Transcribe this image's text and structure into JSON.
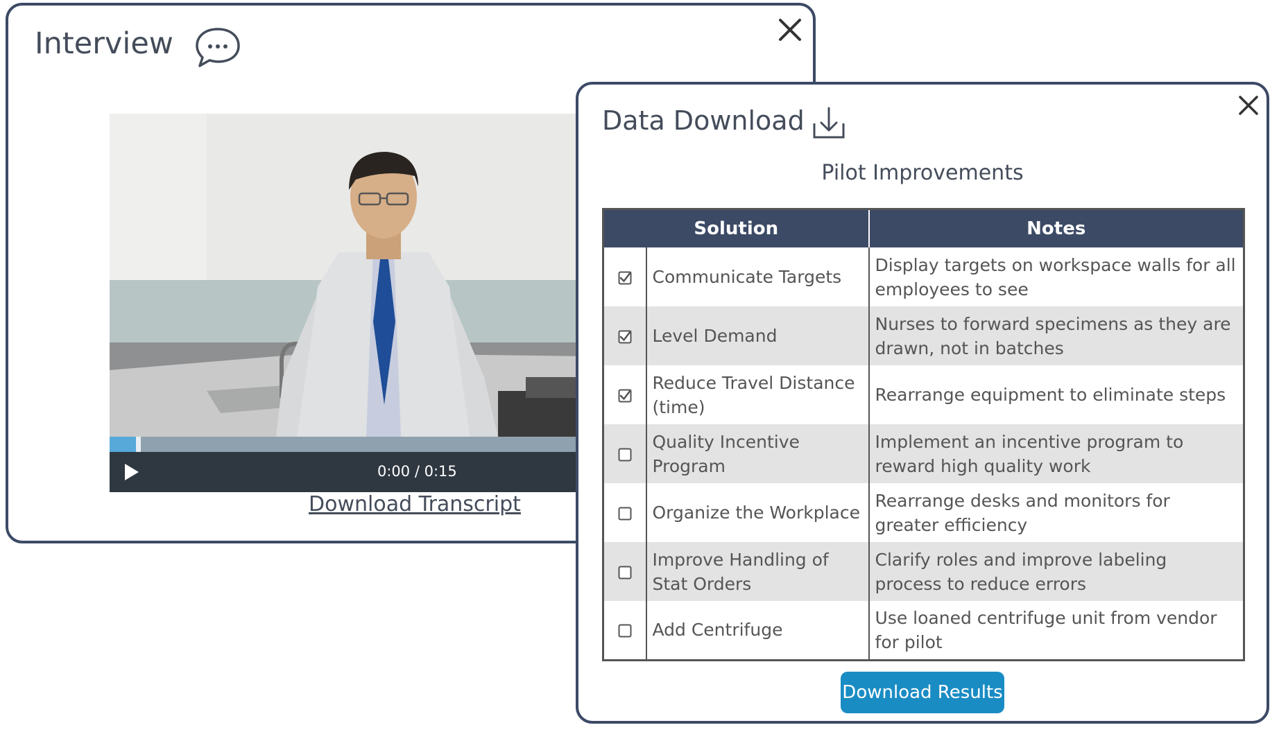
{
  "interview": {
    "title": "Interview",
    "title_icon": "chat-bubble-icon",
    "close_icon": "close-icon",
    "video": {
      "time_display": "0:00 / 0:15",
      "progress_fraction": 0.06,
      "play_icon": "play-icon"
    },
    "transcript_link": "Download Transcript"
  },
  "data_download": {
    "title": "Data Download",
    "title_icon": "download-icon",
    "close_icon": "close-icon",
    "subtitle": "Pilot Improvements",
    "table": {
      "columns": [
        "Solution",
        "Notes"
      ],
      "rows": [
        {
          "checked": true,
          "solution": "Communicate Targets",
          "notes": "Display targets on workspace walls for all employees to see"
        },
        {
          "checked": true,
          "solution": "Level Demand",
          "notes": "Nurses to forward specimens as they are drawn, not in batches"
        },
        {
          "checked": true,
          "solution": "Reduce Travel Distance (time)",
          "notes": "Rearrange equipment to eliminate steps"
        },
        {
          "checked": false,
          "solution": "Quality Incentive Program",
          "notes": "Implement an incentive program to reward high quality work"
        },
        {
          "checked": false,
          "solution": "Organize the Workplace",
          "notes": "Rearrange desks and monitors for greater efficiency"
        },
        {
          "checked": false,
          "solution": "Improve Handling of Stat Orders",
          "notes": "Clarify roles and improve labeling process to reduce errors"
        },
        {
          "checked": false,
          "solution": "Add Centrifuge",
          "notes": "Use loaned centrifuge unit from vendor for pilot"
        }
      ]
    },
    "download_button": "Download Results"
  },
  "colors": {
    "panel_border": "#3c4a66",
    "table_header": "#3c4a66",
    "button": "#1a8cc4",
    "progress_fill": "#56a9d8"
  }
}
